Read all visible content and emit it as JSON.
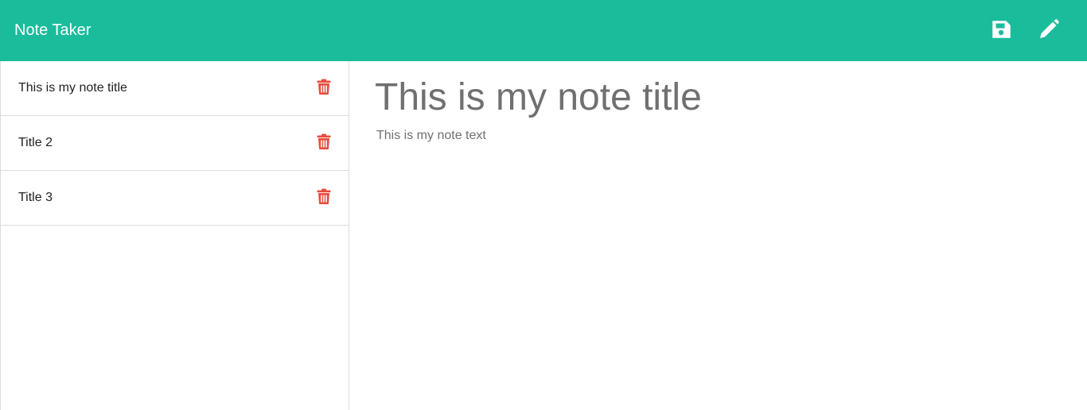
{
  "navbar": {
    "brand": "Note Taker",
    "background_color": "#1abc9c",
    "icons": {
      "save": "floppy-disk-icon",
      "new": "pencil-icon"
    }
  },
  "sidebar": {
    "notes": [
      {
        "title": "This is my note title",
        "delete_icon": "trash-icon"
      },
      {
        "title": "Title 2",
        "delete_icon": "trash-icon"
      },
      {
        "title": "Title 3",
        "delete_icon": "trash-icon"
      }
    ],
    "delete_color": "#e74c3c"
  },
  "editor": {
    "title_value": "This is my note title",
    "text_value": "This is my note text"
  }
}
